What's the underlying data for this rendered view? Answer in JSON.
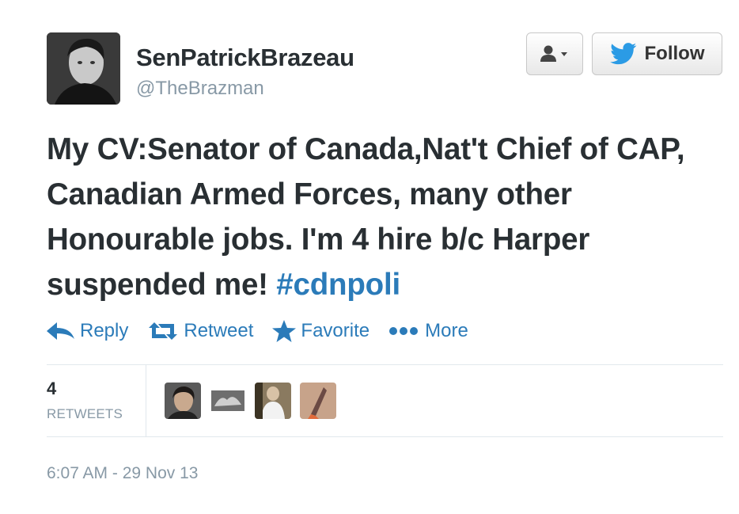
{
  "user": {
    "full_name": "SenPatrickBrazeau",
    "screen_name": "@TheBrazman"
  },
  "buttons": {
    "user_menu_icon": "user-dropdown-icon",
    "follow_label": "Follow"
  },
  "tweet": {
    "text": "My CV:Senator of Canada,Nat't Chief of CAP, Canadian Armed Forces, many other Honourable jobs. I'm 4 hire b/c Harper suspended me!",
    "hashtag": "#cdnpoli"
  },
  "actions": {
    "reply": "Reply",
    "retweet": "Retweet",
    "favorite": "Favorite",
    "more": "More"
  },
  "stats": {
    "retweet_count": "4",
    "retweet_label": "RETWEETS"
  },
  "timestamp": "6:07 AM - 29 Nov 13",
  "colors": {
    "link": "#2b7bb9",
    "text": "#292f33",
    "muted": "#8899a6"
  }
}
